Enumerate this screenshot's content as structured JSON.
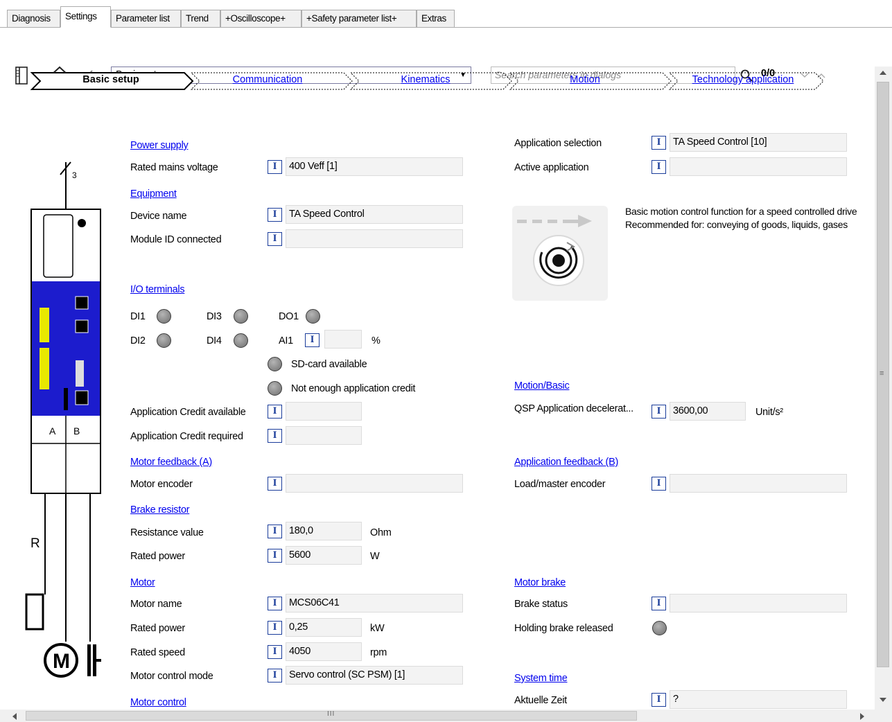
{
  "tabs": [
    "Diagnosis",
    "Settings",
    "Parameter list",
    "Trend",
    "+Oscilloscope+",
    "+Safety parameter list+",
    "Extras"
  ],
  "toolbar": {
    "combo_value": "Basic setup",
    "search_placeholder": "Search parameters in dialogs",
    "hits": "0/0"
  },
  "steps": [
    "Basic setup",
    "Communication",
    "Kinematics",
    "Motion",
    "Technology application"
  ],
  "drive": {
    "phases": "3",
    "port_a": "A",
    "port_b": "B",
    "resistor": "R",
    "motor": "M"
  },
  "info_btn": "I",
  "left": {
    "power_supply": "Power supply",
    "rated_mains_voltage_label": "Rated mains voltage",
    "rated_mains_voltage": "400 Veff [1]",
    "equipment": "Equipment",
    "device_name_label": "Device name",
    "device_name": "TA Speed Control",
    "module_id_label": "Module ID connected",
    "module_id": "",
    "io_terminals": "I/O terminals",
    "di1": "DI1",
    "di2": "DI2",
    "di3": "DI3",
    "di4": "DI4",
    "do1": "DO1",
    "ai1": "AI1",
    "ai1_value": "",
    "ai1_unit": "%",
    "sd_card": "SD-card available",
    "not_enough_credit": "Not enough application credit",
    "credit_available_label": "Application Credit available",
    "credit_available": "",
    "credit_required_label": "Application Credit required",
    "credit_required": "",
    "motor_feedback": "Motor feedback (A)",
    "motor_encoder_label": "Motor encoder",
    "motor_encoder": "",
    "brake_resistor": "Brake resistor",
    "resistance_label": "Resistance value",
    "resistance": "180,0",
    "resistance_unit": "Ohm",
    "br_rated_power_label": "Rated power",
    "br_rated_power": "5600",
    "br_rated_power_unit": "W",
    "motor": "Motor",
    "motor_name_label": "Motor name",
    "motor_name": "MCS06C41",
    "m_rated_power_label": "Rated power",
    "m_rated_power": "0,25",
    "m_rated_power_unit": "kW",
    "rated_speed_label": "Rated speed",
    "rated_speed": "4050",
    "rated_speed_unit": "rpm",
    "motor_control_mode_label": "Motor control mode",
    "motor_control_mode": "Servo control (SC PSM) [1]",
    "motor_control": "Motor control"
  },
  "right": {
    "app_selection_label": "Application selection",
    "app_selection": "TA Speed Control [10]",
    "active_app_label": "Active application",
    "active_app": "",
    "desc_line1": "Basic motion control function for a speed controlled drive",
    "desc_line2": "Recommended for: conveying of goods, liquids, gases",
    "motion_basic": "Motion/Basic",
    "qsp_label": "QSP Application decelerat...",
    "qsp_value": "3600,00",
    "qsp_unit": "Unit/s²",
    "app_feedback": "Application feedback (B)",
    "load_encoder_label": "Load/master encoder",
    "load_encoder": "",
    "motor_brake": "Motor brake",
    "brake_status_label": "Brake status",
    "brake_status": "",
    "holding_brake_label": "Holding brake released",
    "system_time": "System time",
    "current_time_label": "Aktuelle Zeit",
    "current_time": "?"
  },
  "scroll": {
    "h_grip": "III",
    "v_grip": "≡"
  },
  "colors": {
    "link": "#0000ee",
    "info_border": "#1a3c9a",
    "device_blue": "#1c1ccd",
    "led": "#7a7a7a"
  }
}
